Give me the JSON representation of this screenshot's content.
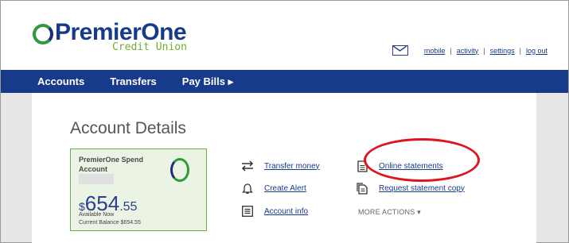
{
  "brand": {
    "name": "PremierOne",
    "subname": "Credit Union"
  },
  "utility": {
    "links": [
      "mobile",
      "activity",
      "settings",
      "log out"
    ]
  },
  "nav": {
    "items": [
      "Accounts",
      "Transfers",
      "Pay Bills ▸"
    ]
  },
  "page": {
    "title": "Account Details"
  },
  "account": {
    "name": "PremierOne Spend Account",
    "currency": "$",
    "balance_whole": "654",
    "balance_cents": ".55",
    "available_label": "Available Now",
    "current_balance": "Current Balance $654.55"
  },
  "actions": {
    "transfer": "Transfer money",
    "alert": "Create Alert",
    "info": "Account info",
    "statements": "Online statements",
    "request": "Request statement copy",
    "more": "MORE ACTIONS ▾"
  },
  "colors": {
    "brand_blue": "#173a8a",
    "brand_green": "#2f9a3a",
    "highlight_red": "#e0141e"
  }
}
